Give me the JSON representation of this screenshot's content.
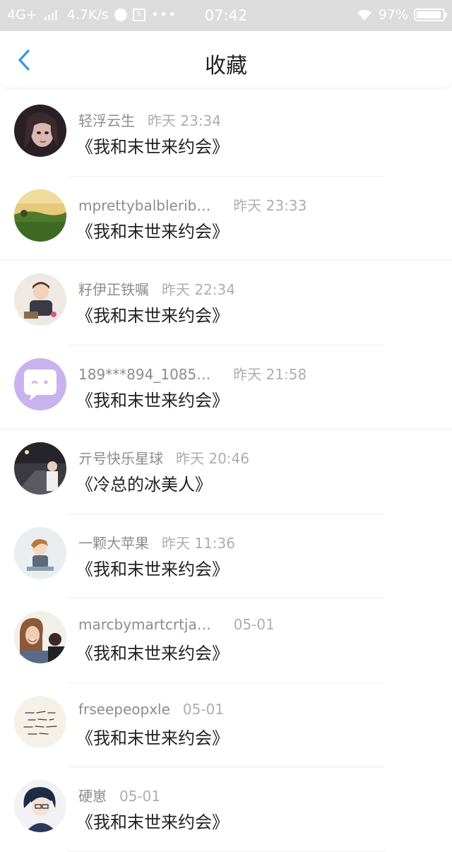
{
  "status_bar": {
    "network": "4G+",
    "speed": "4.7K/s",
    "time": "07:42",
    "battery": "97%",
    "battery_level": 0.97
  },
  "nav": {
    "title": "收藏",
    "back_icon": "chevron-left-icon",
    "accent": "#2f9ae0"
  },
  "items": [
    {
      "name": "轻浮云生",
      "time": "昨天 23:34",
      "book": "《我和末世来约会》"
    },
    {
      "name": "mprettybalblerib…",
      "time": "昨天 23:33",
      "book": "《我和末世来约会》"
    },
    {
      "name": "籽伊正铁嘱",
      "time": "昨天 22:34",
      "book": "《我和末世来约会》"
    },
    {
      "name": "189***894_1085…",
      "time": "昨天 21:58",
      "book": "《我和末世来约会》"
    },
    {
      "name": "亓号快乐星球",
      "time": "昨天 20:46",
      "book": "《冷总的冰美人》"
    },
    {
      "name": "一颗大苹果",
      "time": "昨天 11:36",
      "book": "《我和末世来约会》"
    },
    {
      "name": "marcbymartcrtja…",
      "time": "05-01",
      "book": "《我和末世来约会》"
    },
    {
      "name": "frseepeopxle",
      "time": "05-01",
      "book": "《我和末世来约会》"
    },
    {
      "name": "硬崽",
      "time": "05-01",
      "book": "《我和末世来约会》"
    }
  ]
}
